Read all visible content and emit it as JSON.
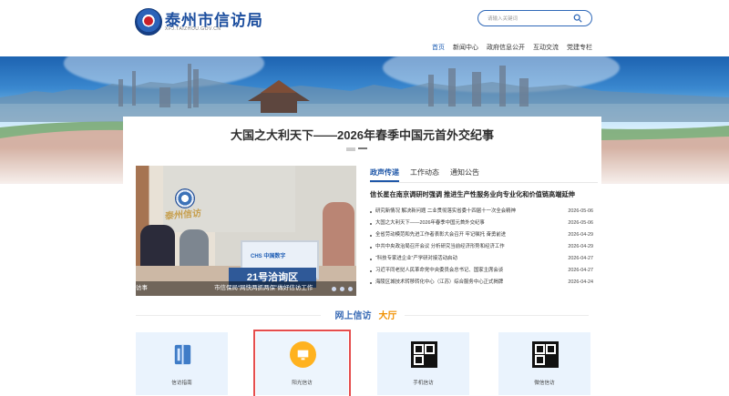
{
  "header": {
    "site_title": "泰州市信访局",
    "site_url": "XFJ.TAIZHOU.GOV.CN",
    "search_placeholder": "请输入关键词"
  },
  "nav": [
    "首页",
    "新闻中心",
    "政府信息公开",
    "互动交流",
    "党建专栏"
  ],
  "headline": "大国之大利天下——2026年春季中国元首外交纪事",
  "photo": {
    "wordmark": "泰州信访",
    "monitor_text": "CHS 中国数字",
    "sign_text": "21号洽询区",
    "caption_left": "访事",
    "caption_right": "市信保局“网快两抓两保”做好信访工作"
  },
  "tabs": [
    "政声传递",
    "工作动态",
    "通知公告"
  ],
  "lead": "信长星在南京调研时强调 推进生产性服务业向专业化和价值链高端延伸",
  "news": [
    {
      "title": "研究新情况 解决新问题 二业贯彻落实省委十四届十一次全会精神",
      "date": "2026-05-06"
    },
    {
      "title": "大国之大利天下——2026年春季中国元首外交纪事",
      "date": "2026-05-06"
    },
    {
      "title": "全省劳动模范和先进工作者表彰大会召开 牢记嘱托 奋勇前进",
      "date": "2026-04-29"
    },
    {
      "title": "中共中央政治局召开会议 分析研究当前经济形势和经济工作",
      "date": "2026-04-29"
    },
    {
      "title": "“科技专家进企业”产学研对接活动启动",
      "date": "2026-04-27"
    },
    {
      "title": "习近平同老挝人民革命党中央委员会总书记、国家主席会谈",
      "date": "2026-04-27"
    },
    {
      "title": "海陵区城技术转移转化中心（江苏）综合服务中心正式揭牌",
      "date": "2026-04-24"
    }
  ],
  "section": {
    "blue": "网上信访",
    "orange": "大厅"
  },
  "cards": [
    "信访指南",
    "阳光信访",
    "手机信访",
    "微信信访"
  ],
  "colors": {
    "primary": "#1f57a8",
    "orange": "#f09000",
    "card_bg": "#eaf3fd",
    "highlight": "#e54d4d"
  }
}
